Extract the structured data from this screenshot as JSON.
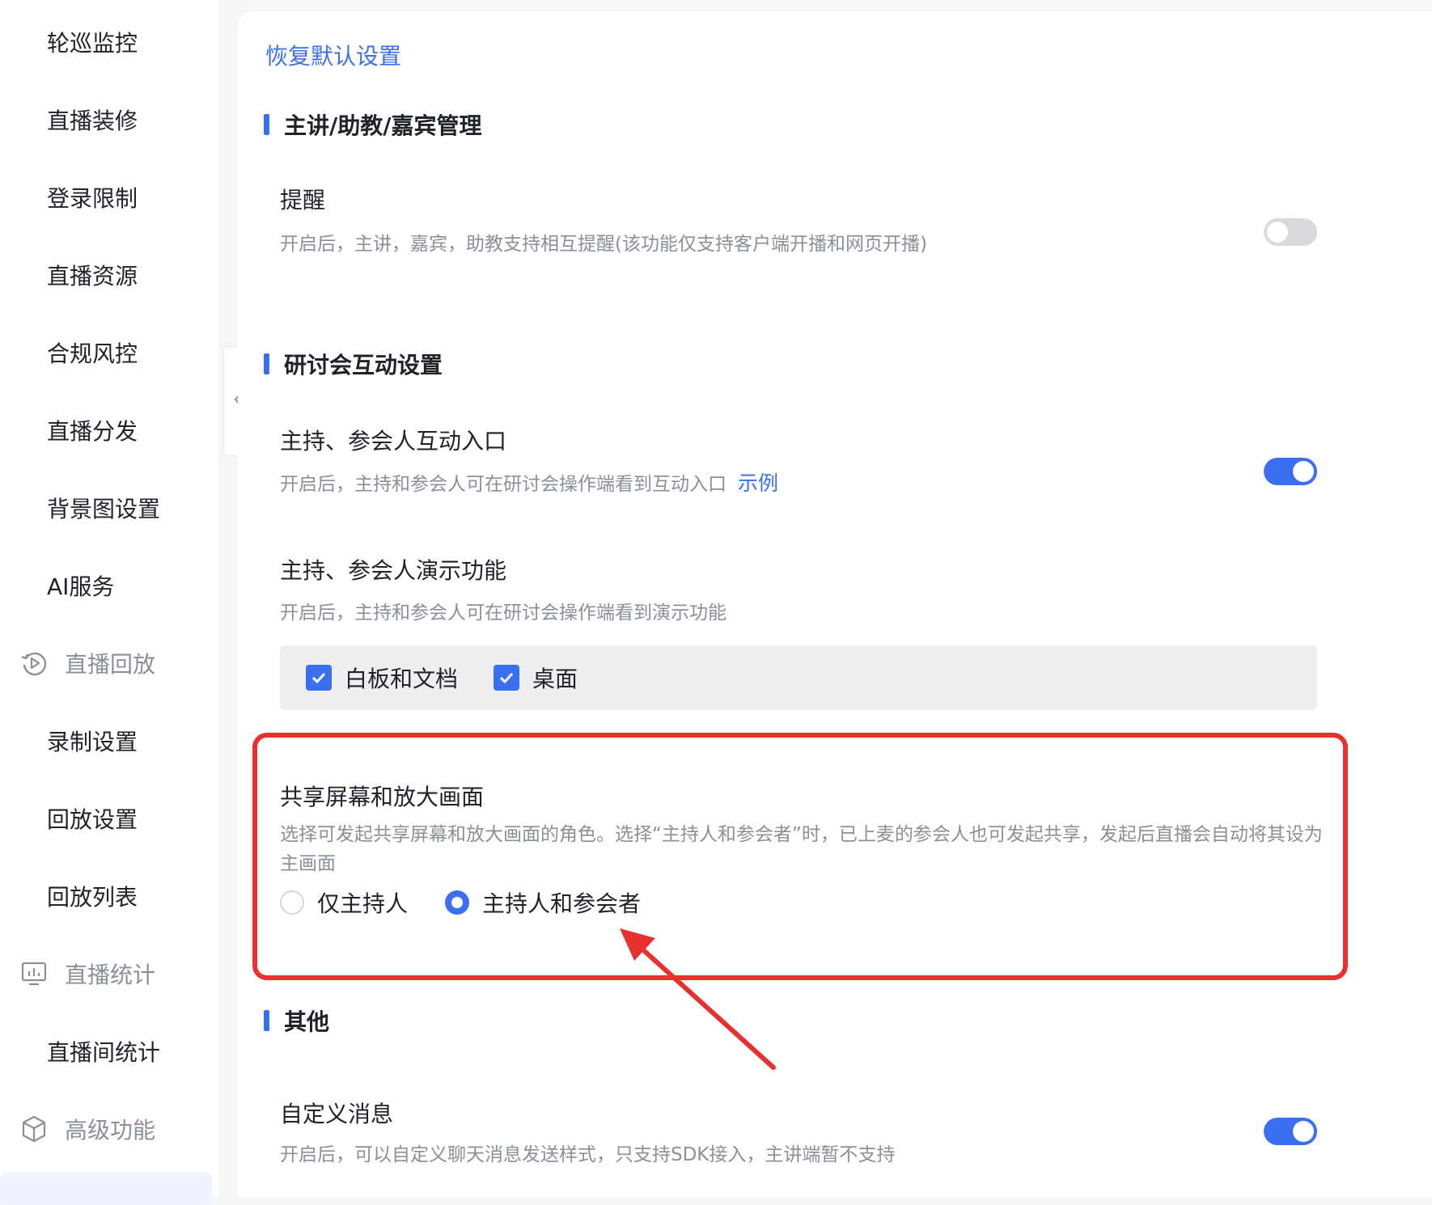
{
  "sidebar": {
    "items": [
      {
        "label": "轮巡监控",
        "kind": "child"
      },
      {
        "label": "直播装修",
        "kind": "child"
      },
      {
        "label": "登录限制",
        "kind": "child"
      },
      {
        "label": "直播资源",
        "kind": "child"
      },
      {
        "label": "合规风控",
        "kind": "child"
      },
      {
        "label": "直播分发",
        "kind": "child"
      },
      {
        "label": "背景图设置",
        "kind": "child"
      },
      {
        "label": "AI服务",
        "kind": "child"
      },
      {
        "label": "直播回放",
        "kind": "group",
        "icon": "playback-icon"
      },
      {
        "label": "录制设置",
        "kind": "child"
      },
      {
        "label": "回放设置",
        "kind": "child"
      },
      {
        "label": "回放列表",
        "kind": "child"
      },
      {
        "label": "直播统计",
        "kind": "group",
        "icon": "statistics-icon"
      },
      {
        "label": "直播间统计",
        "kind": "child"
      },
      {
        "label": "高级功能",
        "kind": "group",
        "icon": "cube-icon"
      }
    ]
  },
  "main": {
    "restore_label": "恢复默认设置",
    "sections": {
      "host": {
        "title": "主讲/助教/嘉宾管理",
        "reminder": {
          "title": "提醒",
          "desc": "开启后，主讲，嘉宾，助教支持相互提醒(该功能仅支持客户端开播和网页开播)",
          "enabled": false
        }
      },
      "seminar": {
        "title": "研讨会互动设置",
        "interact_entry": {
          "title": "主持、参会人互动入口",
          "desc": "开启后，主持和参会人可在研讨会操作端看到互动入口",
          "link": "示例",
          "enabled": true
        },
        "demo": {
          "title": "主持、参会人演示功能",
          "desc": "开启后，主持和参会人可在研讨会操作端看到演示功能",
          "options": [
            {
              "label": "白板和文档",
              "checked": true
            },
            {
              "label": "桌面",
              "checked": true
            }
          ]
        },
        "share_screen": {
          "title": "共享屏幕和放大画面",
          "desc": "选择可发起共享屏幕和放大画面的角色。选择“主持人和参会者”时，已上麦的参会人也可发起共享，发起后直播会自动将其设为主画面",
          "options": [
            {
              "label": "仅主持人",
              "selected": false
            },
            {
              "label": "主持人和参会者",
              "selected": true
            }
          ]
        }
      },
      "other": {
        "title": "其他",
        "custom_msg": {
          "title": "自定义消息",
          "desc": "开启后，可以自定义聊天消息发送样式，只支持SDK接入，主讲端暂不支持",
          "enabled": true
        }
      }
    }
  },
  "colors": {
    "accent": "#3a70f0",
    "highlight": "#e8302f",
    "toggle_off": "#d7d9dd",
    "muted_text": "#8a8f99"
  }
}
